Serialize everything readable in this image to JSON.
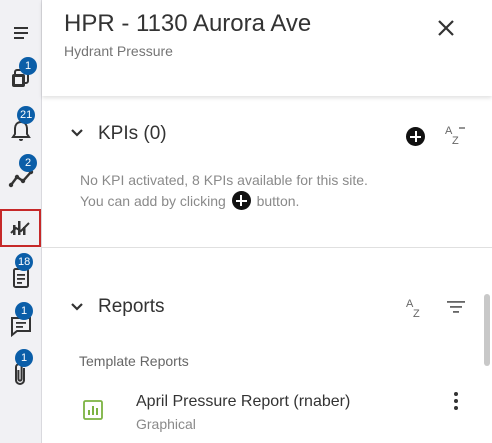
{
  "header": {
    "title": "HPR - 1130 Aurora Ave",
    "subtitle": "Hydrant Pressure"
  },
  "rail": {
    "items": [
      {
        "icon": "menu-icon",
        "badge": ""
      },
      {
        "icon": "layers-icon",
        "badge": "1"
      },
      {
        "icon": "bell-icon",
        "badge": "21"
      },
      {
        "icon": "trend-icon",
        "badge": "2"
      },
      {
        "icon": "analytics-icon",
        "badge": "",
        "active": true
      },
      {
        "icon": "document-icon",
        "badge": "18"
      },
      {
        "icon": "chat-icon",
        "badge": "1"
      },
      {
        "icon": "paperclip-icon",
        "badge": "1"
      }
    ]
  },
  "kpis": {
    "title": "KPIs (0)",
    "info_line1": "No KPI activated, 8 KPIs available for this site.",
    "info_line2_pre": "You can add by clicking",
    "info_line2_post": "button."
  },
  "reports": {
    "title": "Reports",
    "template_label": "Template Reports",
    "items": [
      {
        "name": "April Pressure Report (rnaber)",
        "type": "Graphical"
      }
    ]
  },
  "colors": {
    "badge": "#0b5ea8",
    "active_outline": "#c62828",
    "report_icon": "#7cb342"
  }
}
